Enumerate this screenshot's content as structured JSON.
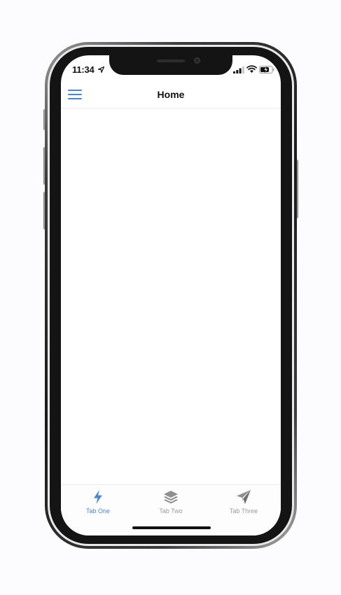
{
  "status_bar": {
    "time": "11:34"
  },
  "nav": {
    "title": "Home"
  },
  "tabs": [
    {
      "label": "Tab One",
      "icon": "lightning-bolt-icon",
      "active": true
    },
    {
      "label": "Tab Two",
      "icon": "layers-icon",
      "active": false
    },
    {
      "label": "Tab Three",
      "icon": "paper-plane-icon",
      "active": false
    }
  ],
  "colors": {
    "accent": "#4a86d8",
    "inactive": "#9a9a9a",
    "text": "#111111"
  }
}
